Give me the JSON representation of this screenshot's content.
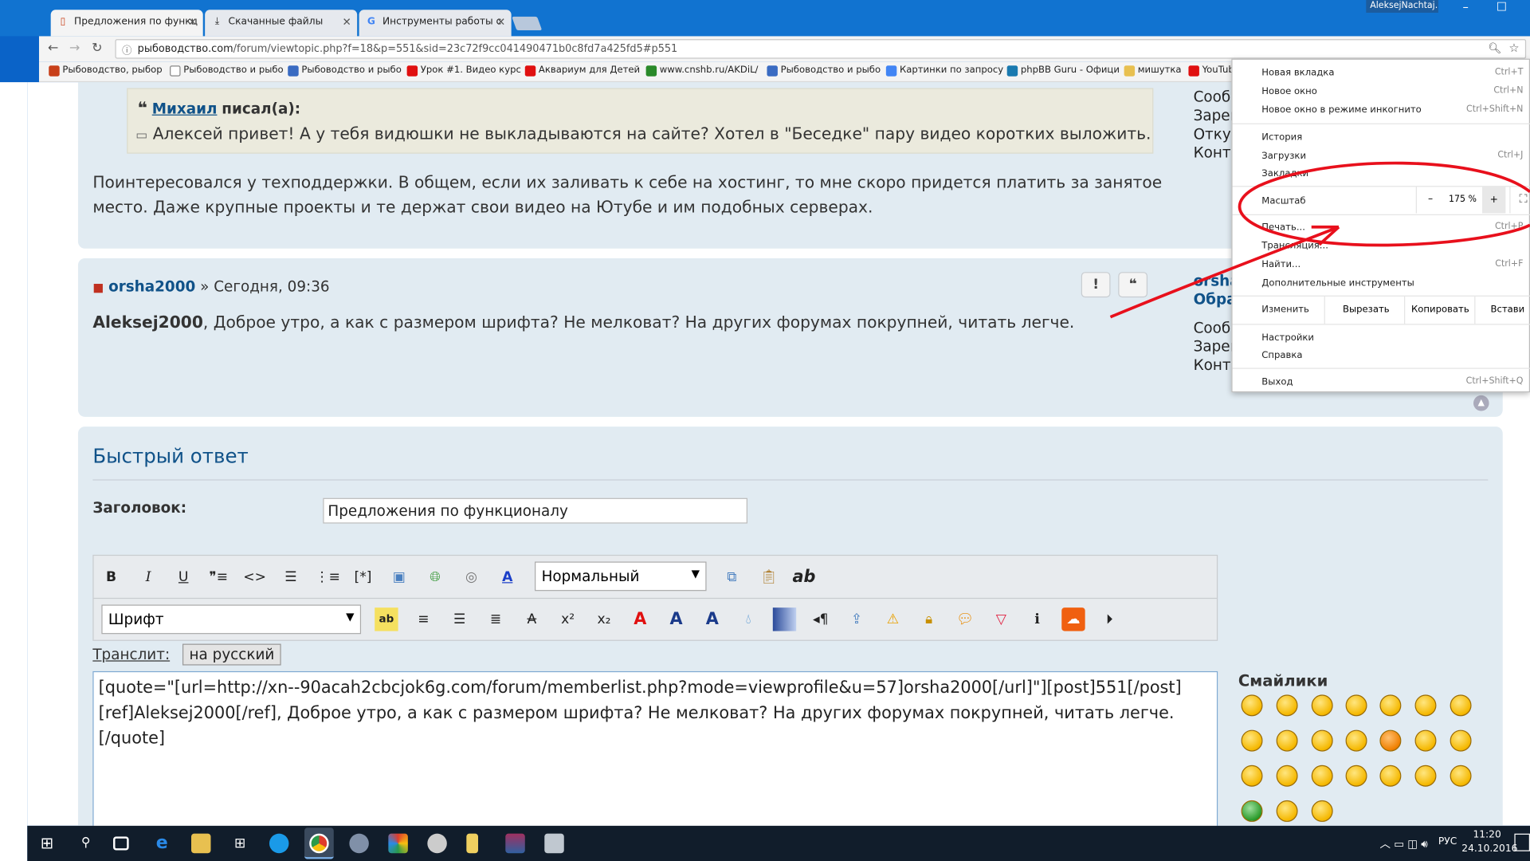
{
  "browser": {
    "tabs": [
      {
        "label": "Предложения по функц",
        "active": true
      },
      {
        "label": "Скачанные файлы",
        "active": false
      },
      {
        "label": "Инструменты работы с",
        "active": false
      }
    ],
    "user": "AleksejNachtaj...",
    "window_buttons": {
      "minimize": "–",
      "maximize": "☐"
    },
    "url_host": "рыбоводство.com",
    "url_path": "/forum/viewtopic.php?f=18&p=551&sid=23c72f9cc041490471b0c8fd7a425fd5#p551",
    "bookmarks": [
      {
        "label": "Рыбоводство, рыбор",
        "color": "#c8401a"
      },
      {
        "label": "Рыбоводство и рыбо",
        "color": "#888"
      },
      {
        "label": "Рыбоводство и рыбо",
        "color": "#3a6bc2"
      },
      {
        "label": "Урок #1. Видео курс",
        "color": "#e01010"
      },
      {
        "label": "Аквариум для Детей",
        "color": "#e01010"
      },
      {
        "label": "www.cnshb.ru/AKDiL/",
        "color": "#2a8a2a"
      },
      {
        "label": "Рыбоводство и рыбо",
        "color": "#3a6bc2"
      },
      {
        "label": "Картинки по запросу",
        "color": "#4285f4"
      },
      {
        "label": "phpBB Guru - Офици",
        "color": "#1a7ab0"
      },
      {
        "label": "мишутка",
        "color": "#e8c050"
      },
      {
        "label": "YouTub",
        "color": "#e01010"
      }
    ]
  },
  "post1": {
    "quote_author": "Михаил",
    "quote_suffix": "писал(а):",
    "quote_text": "Алексей привет! А у тебя видюшки не выкладываются на сайте? Хотел в \"Беседке\" пару видео коротких выложить.",
    "text_line1": "Поинтересовался у техподдержки. В общем, если их заливать к себе на хостинг, то мне скоро придется платить за занятое",
    "text_line2": "место. Даже крупные проекты и те держат свои видео на Ютубе и им подобных серверах.",
    "profile": [
      "Сооб",
      "Зарег",
      "Откуд",
      "Конта"
    ]
  },
  "post2": {
    "author": "orsha2000",
    "date": "» Сегодня, 09:36",
    "mention": "Aleksej2000",
    "text": ", Доброе утро, а как с размером шрифта? Не мелковат? На других форумах покрупней, читать легче.",
    "btn_report": "!",
    "btn_quote": "❝",
    "profile_name": [
      "orsha",
      "Обра"
    ],
    "profile": [
      "Сооб",
      "Зарег",
      "Конта"
    ]
  },
  "reply": {
    "title": "Быстрый ответ",
    "subject_label": "Заголовок:",
    "subject_value": "Предложения по функционалу",
    "size_select": "Нормальный",
    "font_select": "Шрифт",
    "translit_label": "Транслит:",
    "translit_button": "на русский",
    "content": "[quote=\"[url=http://xn--90acah2cbcjok6g.com/forum/memberlist.php?mode=viewprofile&u=57]orsha2000[/url]\"][post]551[/post]\n[ref]Aleksej2000[/ref], Доброе утро, а как с размером шрифта? Не мелковат? На других форумах покрупней, читать легче.\n[/quote]",
    "smilies_title": "Смайлики"
  },
  "menu": {
    "new_tab": "Новая вкладка",
    "new_tab_sc": "Ctrl+T",
    "new_window": "Новое окно",
    "new_window_sc": "Ctrl+N",
    "incognito": "Новое окно в режиме инкогнито",
    "incognito_sc": "Ctrl+Shift+N",
    "history": "История",
    "downloads": "Загрузки",
    "downloads_sc": "Ctrl+J",
    "bookmarks": "Закладки",
    "zoom_label": "Масштаб",
    "zoom_minus": "–",
    "zoom_value": "175 %",
    "zoom_plus": "+",
    "print": "Печать...",
    "print_sc": "Ctrl+P",
    "cast": "Трансляция...",
    "find": "Найти...",
    "find_sc": "Ctrl+F",
    "more_tools": "Дополнительные инструменты",
    "edit": "Изменить",
    "cut": "Вырезать",
    "copy": "Копировать",
    "paste": "Встави",
    "settings": "Настройки",
    "help": "Справка",
    "exit": "Выход",
    "exit_sc": "Ctrl+Shift+Q"
  },
  "taskbar": {
    "lang": "РУС",
    "time": "11:20",
    "date": "24.10.2016"
  },
  "colors": {
    "annotation": "#e8101c",
    "link": "#105289",
    "titlebar": "#1173d0"
  }
}
